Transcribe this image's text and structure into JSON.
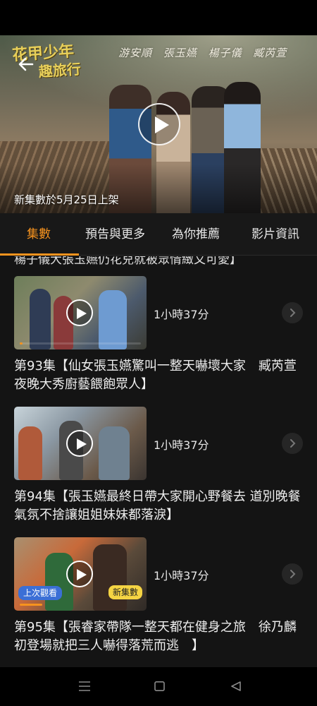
{
  "hero": {
    "show_logo_line1": "花甲少年",
    "show_logo_line2": "趣旅行",
    "cast": "游安順 張玉嬿 楊子儀 臧芮萱",
    "notice": "新集數於5月25日上架",
    "back_icon": "arrow-left-icon",
    "play_icon": "play-icon"
  },
  "tabs": [
    {
      "label": "集數",
      "active": true
    },
    {
      "label": "預告與更多",
      "active": false
    },
    {
      "label": "為你推薦",
      "active": false
    },
    {
      "label": "影片資訊",
      "active": false
    }
  ],
  "accent_color": "#f7931e",
  "cut_off_text": "楊子儀大張玉嬿仍花兒就被眾情緻又可愛】",
  "episodes": [
    {
      "duration": "1小時37分",
      "title": "第93集【仙女張玉嬿驚叫一整天嚇壞大家　臧芮萱夜晚大秀廚藝餵飽眾人】",
      "progress": 0.02
    },
    {
      "duration": "1小時37分",
      "title": "第94集【張玉嬿最終日帶大家開心野餐去 道別晚餐氣氛不捨讓姐姐妹妹都落淚】",
      "progress": 0
    },
    {
      "duration": "1小時37分",
      "title": "第95集【張睿家帶隊一整天都在健身之旅　徐乃麟初登場就把三人嚇得落荒而逃　】",
      "badge_last_watched": "上次觀看",
      "badge_new": "新集數",
      "progress": 0.18
    }
  ],
  "nav": {
    "menu_icon": "menu-icon",
    "home_icon": "square-home-icon",
    "back_icon": "triangle-back-icon"
  }
}
